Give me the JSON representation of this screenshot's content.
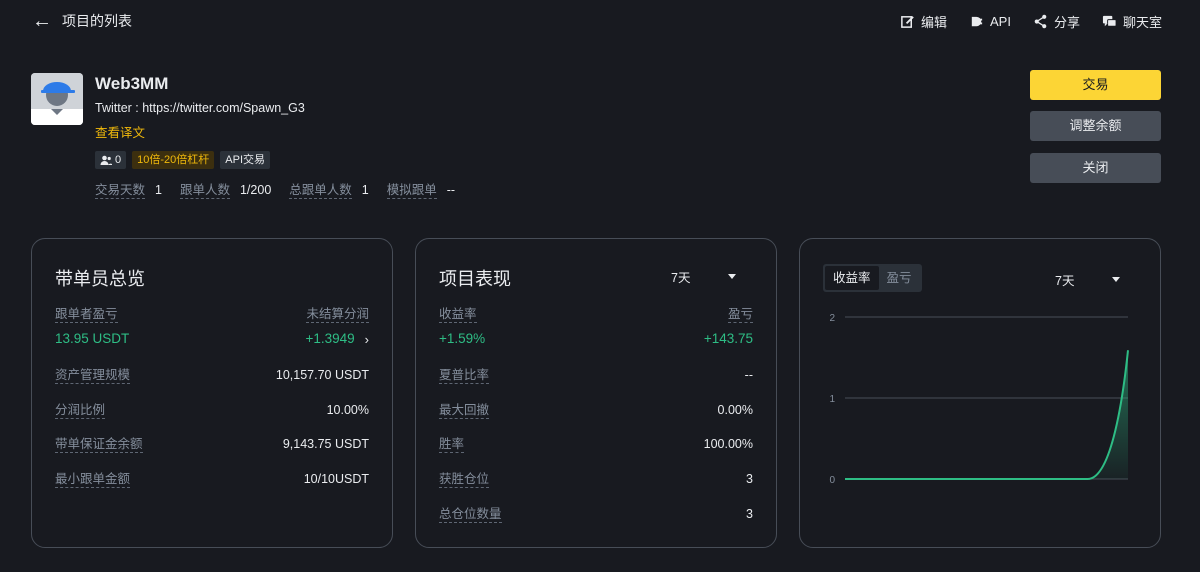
{
  "header": {
    "back_label": "项目的列表",
    "actions": [
      {
        "label": "编辑",
        "icon": "edit-icon"
      },
      {
        "label": "API",
        "icon": "api-icon"
      },
      {
        "label": "分享",
        "icon": "share-icon"
      },
      {
        "label": "聊天室",
        "icon": "chat-icon"
      }
    ]
  },
  "profile": {
    "name": "Web3MM",
    "twitter": "Twitter : https://twitter.com/Spawn_G3",
    "translate_link": "查看译文",
    "tags": {
      "followers": "0",
      "leverage": "10倍-20倍杠杆",
      "api": "API交易"
    },
    "stats": [
      {
        "label": "交易天数",
        "value": "1"
      },
      {
        "label": "跟单人数",
        "value": "1/200"
      },
      {
        "label": "总跟单人数",
        "value": "1"
      },
      {
        "label": "模拟跟单",
        "value": "--"
      }
    ]
  },
  "buttons": {
    "trade": "交易",
    "adjust": "调整余额",
    "close": "关闭"
  },
  "overview": {
    "title": "带单员总览",
    "pnl_label": "跟单者盈亏",
    "pnl_value": "13.95 USDT",
    "unsettled_label": "未结算分润",
    "unsettled_value": "+1.3949",
    "rows": [
      {
        "label": "资产管理规模",
        "value": "10,157.70 USDT"
      },
      {
        "label": "分润比例",
        "value": "10.00%"
      },
      {
        "label": "带单保证金余额",
        "value": "9,143.75 USDT"
      },
      {
        "label": "最小跟单金额",
        "value": "10/10USDT"
      }
    ]
  },
  "performance": {
    "title": "项目表现",
    "period": "7天",
    "roi_label": "收益率",
    "roi_value": "+1.59%",
    "pnl_label": "盈亏",
    "pnl_value": "+143.75",
    "rows": [
      {
        "label": "夏普比率",
        "value": "--"
      },
      {
        "label": "最大回撤",
        "value": "0.00%"
      },
      {
        "label": "胜率",
        "value": "100.00%"
      },
      {
        "label": "获胜仓位",
        "value": "3"
      },
      {
        "label": "总仓位数量",
        "value": "3"
      }
    ]
  },
  "chart_panel": {
    "tab_roi": "收益率",
    "tab_pnl": "盈亏",
    "period": "7天"
  },
  "colors": {
    "accent": "#fcd535",
    "positive": "#2ebd85",
    "background": "#181a20"
  },
  "chart_data": {
    "type": "area",
    "x": [
      0,
      1,
      2,
      3,
      4,
      5,
      6,
      7
    ],
    "series": [
      {
        "values": [
          0,
          0,
          0,
          0,
          0,
          0,
          0,
          1.59
        ]
      }
    ],
    "ylim": [
      0,
      2
    ],
    "yticks": [
      "0",
      "1",
      "2"
    ],
    "grid": true
  }
}
